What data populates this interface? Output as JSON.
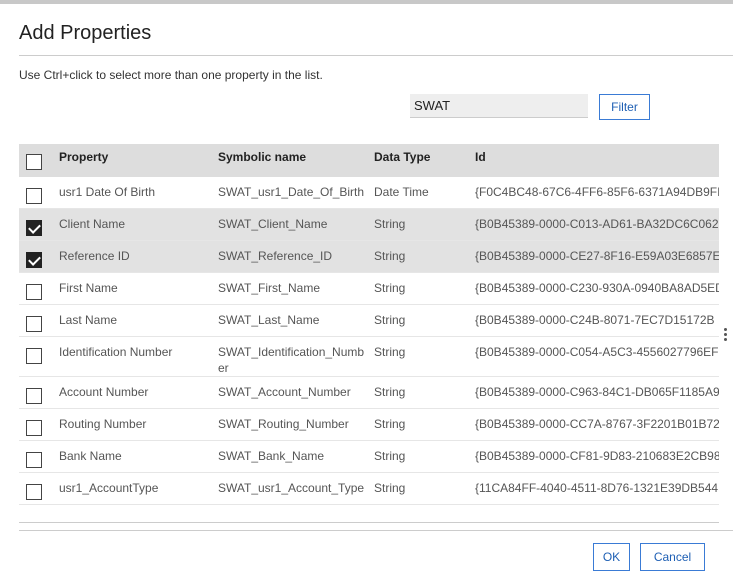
{
  "dialog": {
    "title": "Add Properties",
    "instructions": "Use Ctrl+click to select more than one property in the list."
  },
  "filter": {
    "value": "SWAT",
    "button_label": "Filter"
  },
  "table": {
    "headers": {
      "property": "Property",
      "symbolic_name": "Symbolic name",
      "data_type": "Data Type",
      "id": "Id"
    },
    "rows": [
      {
        "checked": false,
        "property": "usr1 Date Of Birth",
        "symbolic_name": "SWAT_usr1_Date_Of_Birth",
        "data_type": "Date Time",
        "id": "{F0C4BC48-67C6-4FF6-85F6-6371A94DB9FI"
      },
      {
        "checked": true,
        "property": "Client Name",
        "symbolic_name": "SWAT_Client_Name",
        "data_type": "String",
        "id": "{B0B45389-0000-C013-AD61-BA32DC6C062"
      },
      {
        "checked": true,
        "property": "Reference ID",
        "symbolic_name": "SWAT_Reference_ID",
        "data_type": "String",
        "id": "{B0B45389-0000-CE27-8F16-E59A03E6857E"
      },
      {
        "checked": false,
        "property": "First Name",
        "symbolic_name": "SWAT_First_Name",
        "data_type": "String",
        "id": "{B0B45389-0000-C230-930A-0940BA8AD5ED"
      },
      {
        "checked": false,
        "property": "Last Name",
        "symbolic_name": "SWAT_Last_Name",
        "data_type": "String",
        "id": "{B0B45389-0000-C24B-8071-7EC7D15172B"
      },
      {
        "checked": false,
        "property": "Identification Number",
        "symbolic_name": "SWAT_Identification_Number",
        "data_type": "String",
        "id": "{B0B45389-0000-C054-A5C3-4556027796EF"
      },
      {
        "checked": false,
        "property": "Account Number",
        "symbolic_name": "SWAT_Account_Number",
        "data_type": "String",
        "id": "{B0B45389-0000-C963-84C1-DB065F1185A9"
      },
      {
        "checked": false,
        "property": "Routing Number",
        "symbolic_name": "SWAT_Routing_Number",
        "data_type": "String",
        "id": "{B0B45389-0000-CC7A-8767-3F2201B01B72"
      },
      {
        "checked": false,
        "property": "Bank Name",
        "symbolic_name": "SWAT_Bank_Name",
        "data_type": "String",
        "id": "{B0B45389-0000-CF81-9D83-210683E2CB98"
      },
      {
        "checked": false,
        "property": "usr1_AccountType",
        "symbolic_name": "SWAT_usr1_Account_Type",
        "data_type": "String",
        "id": "{11CA84FF-4040-4511-8D76-1321E39DB544"
      }
    ]
  },
  "footer": {
    "ok_label": "OK",
    "cancel_label": "Cancel"
  }
}
